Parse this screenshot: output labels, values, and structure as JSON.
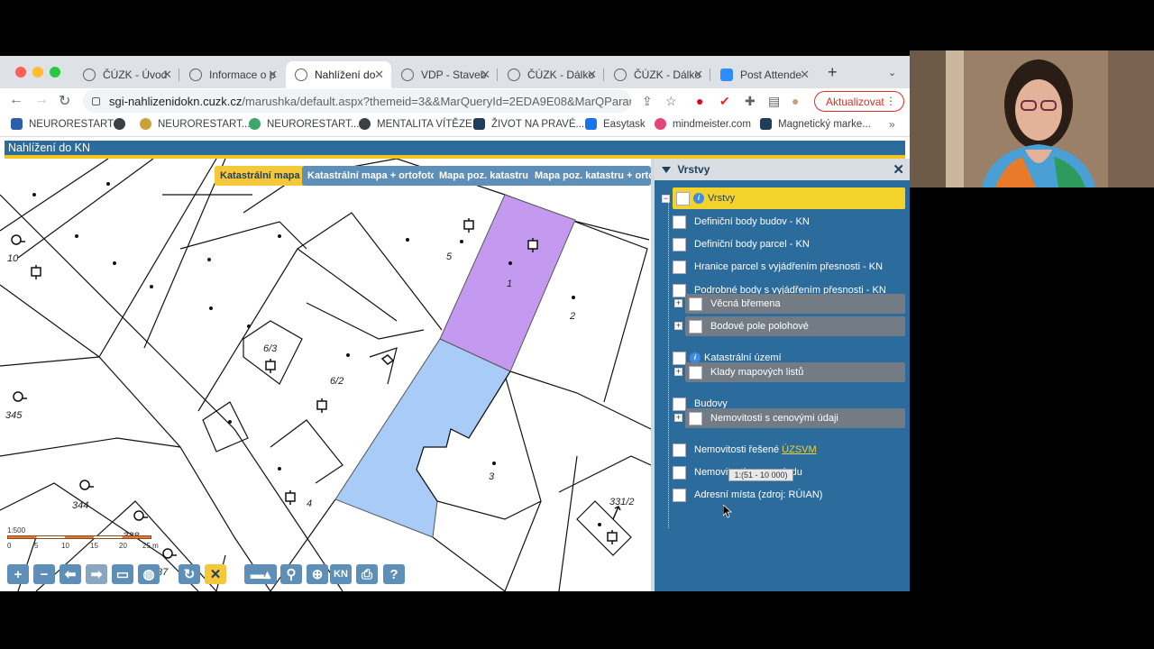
{
  "browser": {
    "tabs": [
      {
        "label": "ČÚZK - Úvod",
        "active": false
      },
      {
        "label": "Informace o p",
        "active": false
      },
      {
        "label": "Nahlížení do",
        "active": true
      },
      {
        "label": "VDP - Staveb",
        "active": false
      },
      {
        "label": "ČÚZK - Dálko",
        "active": false
      },
      {
        "label": "ČÚZK - Dálko",
        "active": false
      },
      {
        "label": "Post Attende",
        "active": false
      }
    ],
    "address": {
      "host": "sgi-nahlizenidokn.cuzk.cz",
      "path": "/marushka/default.aspx?themeid=3&&MarQueryId=2EDA9E08&MarQParam0..."
    },
    "update_label": "Aktualizovat",
    "bookmarks": [
      "NEURORESTART",
      "",
      "NEURORESTART...",
      "NEURORESTART...",
      "MENTALITA VÍTĚZE",
      "ŽIVOT NA PRAVÉ...",
      "Easytask",
      "mindmeister.com",
      "Magnetický marke..."
    ]
  },
  "page": {
    "header_title": "Nahlížení do KN"
  },
  "map": {
    "tabs": [
      {
        "label": "Katastrální mapa",
        "active": true
      },
      {
        "label": "Katastrální mapa + ortofoto",
        "active": false
      },
      {
        "label": "Mapa poz. katastru",
        "active": false
      },
      {
        "label": "Mapa poz. katastru + ortofo",
        "active": false
      }
    ],
    "parcel_labels": [
      "10",
      "345",
      "344",
      "338",
      "87",
      "5",
      "1",
      "2",
      "6/3",
      "6/2",
      "4",
      "3",
      "331/2"
    ],
    "scale": {
      "ratio": "1:500",
      "ticks": [
        "0",
        "5",
        "10",
        "15",
        "20",
        "25 m"
      ]
    },
    "toolbar": {
      "kn_label": "KN"
    },
    "colors": {
      "highlight_purple": "#c39af0",
      "highlight_blue": "#a9cbf7"
    }
  },
  "layers": {
    "title": "Vrstvy",
    "root_label": "Vrstvy",
    "items": [
      {
        "label": "Definiční body budov - KN",
        "group": false
      },
      {
        "label": "Definiční body parcel - KN",
        "group": false
      },
      {
        "label": "Hranice parcel s vyjádřením přesnosti - KN",
        "group": false
      },
      {
        "label": "Podrobné body s vyjádřením přesnosti - KN",
        "group": false
      },
      {
        "label": "Věcná břemena",
        "group": true
      },
      {
        "label": "Bodové pole polohové",
        "group": true
      },
      {
        "label": "Katastrální území",
        "group": false,
        "info": true
      },
      {
        "label": "Klady mapových listů",
        "group": true
      },
      {
        "label": "Budovy",
        "group": false
      },
      {
        "label": "Nemovitosti s cenovými údaji",
        "group": true
      },
      {
        "label": "Nemovitosti řešené",
        "group": false,
        "link": "ÚZSVM"
      },
      {
        "label": "Nemovitosti v nesouladu",
        "group": false
      },
      {
        "label": "Adresní místa (zdroj: RÚIAN)",
        "group": false
      }
    ],
    "tooltip": "1:(51 - 10 000)"
  }
}
